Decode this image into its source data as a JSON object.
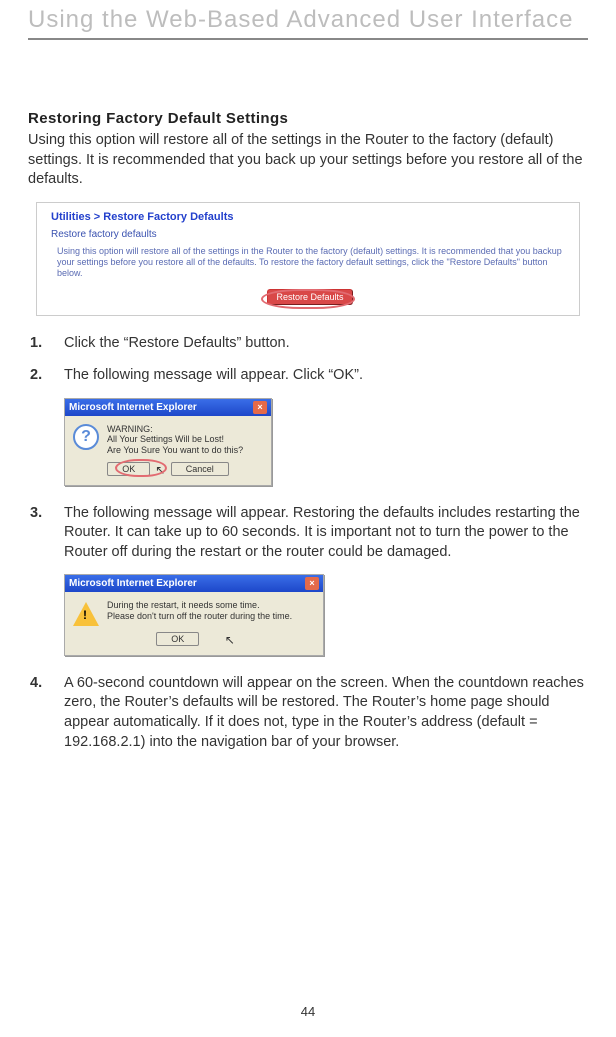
{
  "chapter_title": "Using the Web-Based Advanced User Interface",
  "section_heading": "Restoring Factory Default Settings",
  "intro": "Using this option will restore all of the settings in the Router to the factory (default) settings. It is recommended that you back up your settings before you restore all of the defaults.",
  "util_pane": {
    "breadcrumb": "Utilities > Restore Factory Defaults",
    "subheading": "Restore factory defaults",
    "body": "Using this option will restore all of the settings in the Router to the factory (default) settings. It is recommended that you backup your settings before you restore all of the defaults. To restore the factory default settings, click the \"Restore Defaults\" button below.",
    "button": "Restore Defaults"
  },
  "steps": {
    "s1": {
      "num": "1.",
      "text": "Click the “Restore Defaults” button."
    },
    "s2": {
      "num": "2.",
      "text": "The following message will appear. Click “OK”."
    },
    "s3": {
      "num": "3.",
      "text": "The following message will appear. Restoring the defaults includes restarting the Router. It can take up to 60 seconds. It is important not to turn the power to the Router off during the restart or the router could be damaged."
    },
    "s4": {
      "num": "4.",
      "text": "A 60-second countdown will appear on the screen. When the countdown reaches zero, the Router’s defaults will be restored. The Router’s home page should appear automatically. If it does not, type in the Router’s address (default = 192.168.2.1) into the navigation bar of your browser."
    }
  },
  "dialog1": {
    "title": "Microsoft Internet Explorer",
    "line1": "WARNING:",
    "line2": "All Your Settings Will be Lost!",
    "line3": "Are You Sure You want to do this?",
    "ok": "OK",
    "cancel": "Cancel"
  },
  "dialog2": {
    "title": "Microsoft Internet Explorer",
    "line1": "During the restart, it needs some time.",
    "line2": "Please don't turn off the router during the time.",
    "ok": "OK"
  },
  "page_number": "44"
}
